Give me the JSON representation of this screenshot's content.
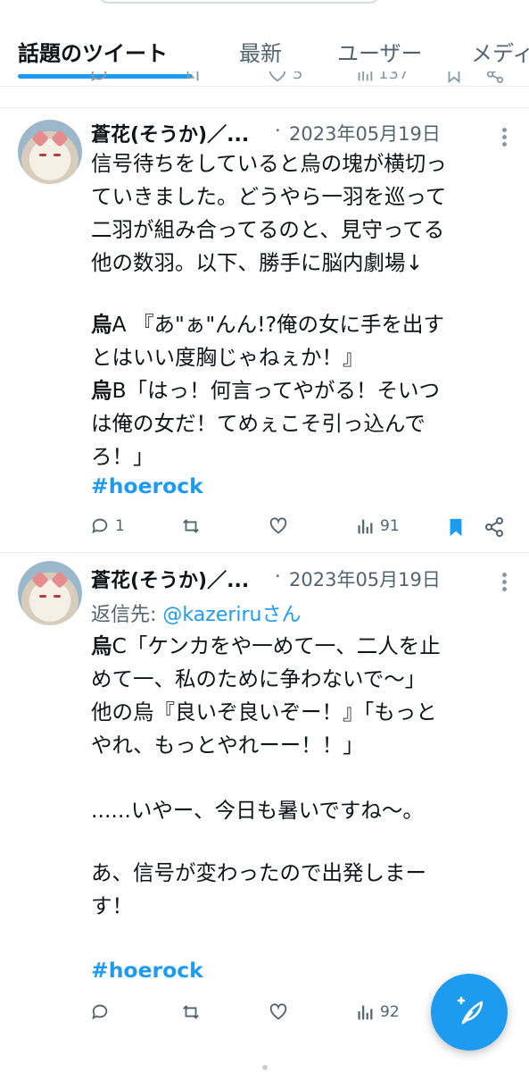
{
  "tabs": [
    {
      "label": "話題のツイート",
      "active": true
    },
    {
      "label": "最新"
    },
    {
      "label": "ユーザー"
    },
    {
      "label": "メディア"
    }
  ],
  "tweets": [
    {
      "user": "蒼花(そうか)／...",
      "dot": "·",
      "date": "2023年05月19日",
      "lines": [
        {
          "text": "信号待ちをしていると烏の塊が横切っ"
        },
        {
          "text": "ていきました。どうやら一羽を巡って"
        },
        {
          "text": "二羽が組み合ってるのと、見守ってる"
        },
        {
          "text": "他の数羽。以下、勝手に脳内劇場↓"
        },
        {
          "speaker": "烏",
          "text": "A 『あ\"ぁ\"んん!?俺の女に手を出す"
        },
        {
          "text": "とはいい度胸じゃねぇか！』"
        },
        {
          "speaker": "烏",
          "text": "B「はっ！何言ってやがる！そいつ"
        },
        {
          "text": "は俺の女だ！てめぇこそ引っ込んで"
        },
        {
          "text": "ろ！」"
        }
      ],
      "hashtag": "#hoerock",
      "replies": "1",
      "views": "91",
      "bookmarked": true
    },
    {
      "user": "蒼花(そうか)／...",
      "dot": "·",
      "date": "2023年05月19日",
      "reply_prefix": "返信先: ",
      "reply_handle": "@kazeriru",
      "reply_suffix": "さん",
      "lines": [
        {
          "speaker": "烏",
          "text": "C「ケンカをや一めて一、二人を止"
        },
        {
          "text": "めて一、私のために争わないで〜」"
        },
        {
          "text": "他の烏『良いぞ良いぞー！』「もっと"
        },
        {
          "text": "やれ、もっとやれーー！！」"
        },
        {
          "text": "......いやー、今日も暑いですね〜。"
        },
        {
          "text": "あ、信号が変わったので出発しまー"
        },
        {
          "text": "す！"
        }
      ],
      "hashtag": "#hoerock",
      "replies": "",
      "views": "92",
      "bookmarked": false
    }
  ],
  "prev_tweet_actions": {
    "likes": "5",
    "views": "137"
  },
  "colors": {
    "accent": "#1d9bf0",
    "text": "#0f1419",
    "muted": "#536471"
  },
  "fab_icon": "compose-feather-icon"
}
